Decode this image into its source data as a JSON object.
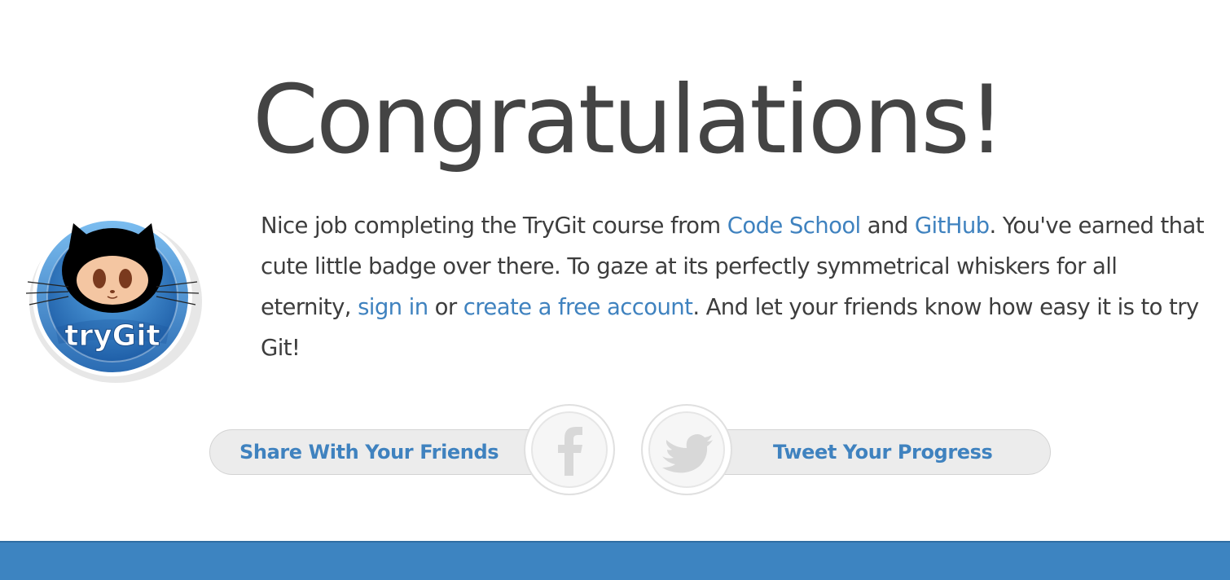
{
  "title": "Congratulations!",
  "badge": {
    "icon": "trygit-octocat-badge-icon",
    "logo_text": "tryGit"
  },
  "message": {
    "part1": "Nice job completing the TryGit course from ",
    "link_code_school": "Code School",
    "part2": " and ",
    "link_github": "GitHub",
    "part3": ". You've earned that cute little badge over there. To gaze at its perfectly symmetrical whiskers for all eternity, ",
    "link_sign_in": "sign in",
    "part4": " or ",
    "link_create_account": "create a free account",
    "part5": ". And let your friends know how easy it is to try Git!"
  },
  "share": {
    "facebook_label": "Share With Your Friends",
    "facebook_icon": "facebook-icon",
    "twitter_label": "Tweet Your Progress",
    "twitter_icon": "twitter-bird-icon"
  },
  "colors": {
    "link": "#3f82bf",
    "text": "#3d3d3d",
    "title": "#444444",
    "footer": "#3d84c1",
    "button_bg": "#ececec"
  }
}
